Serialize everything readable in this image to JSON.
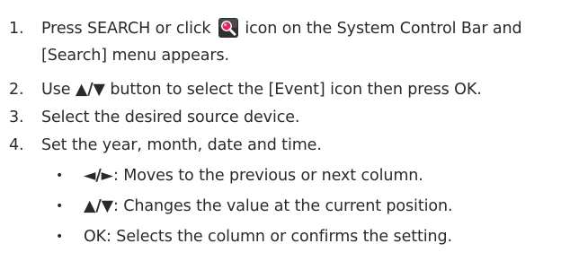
{
  "steps": [
    {
      "number": "1.",
      "part1": "Press SEARCH or click",
      "icon": "search-icon",
      "part2": "icon on the System Control Bar and",
      "line2": "[Search] menu appears."
    },
    {
      "number": "2.",
      "prefix": "Use",
      "symbol": "▲/▼",
      "suffix": "button to select the [Event] icon then press OK."
    },
    {
      "number": "3.",
      "text": "Select the desired source device."
    },
    {
      "number": "4.",
      "text": "Set the year, month, date and time."
    }
  ],
  "subitems": [
    {
      "bullet": "•",
      "symbol": "◄/►",
      "text": ": Moves to the previous or next column."
    },
    {
      "bullet": "•",
      "symbol": "▲/▼",
      "text": ": Changes the value at the current position."
    },
    {
      "bullet": "•",
      "text": "OK: Selects the column or confirms the setting."
    }
  ],
  "colors": {
    "text": "#2a2a2a",
    "icon_background": "#2f2f2f",
    "icon_lens": "#e0245e"
  }
}
